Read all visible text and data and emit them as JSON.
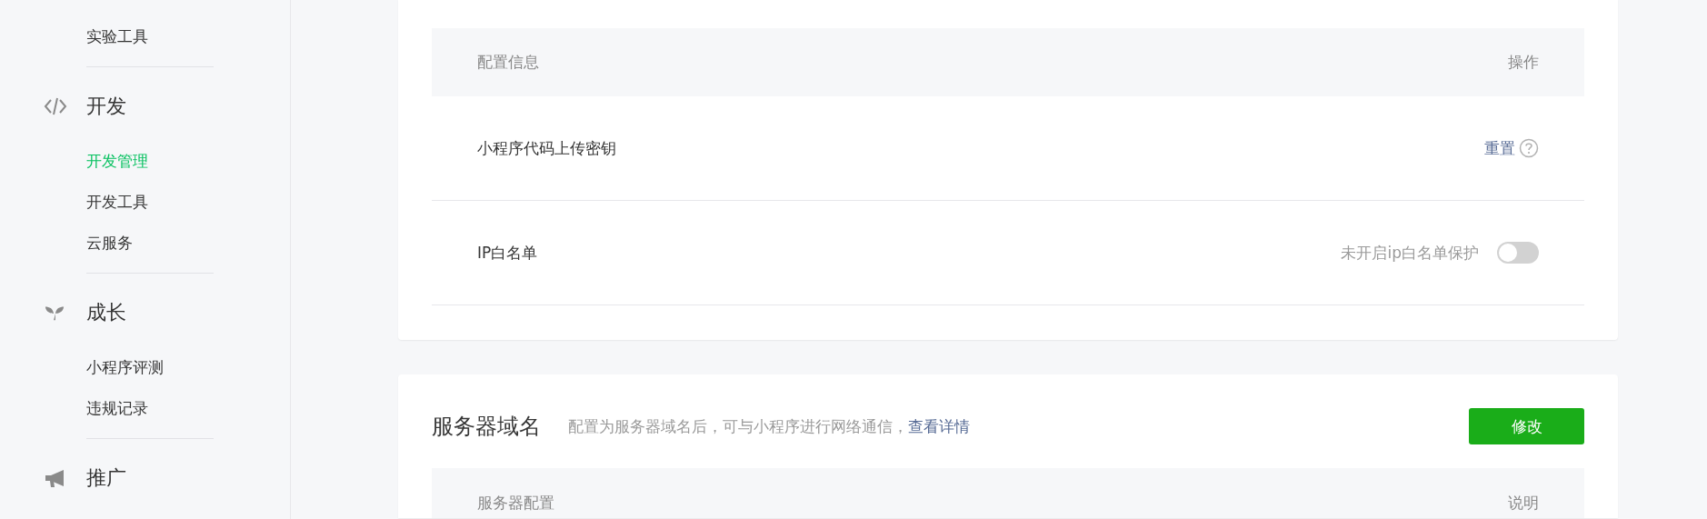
{
  "sidebar": {
    "sections": [
      {
        "items": [
          {
            "label": "实验工具",
            "selected": false
          }
        ]
      },
      {
        "title": "开发",
        "items": [
          {
            "label": "开发管理",
            "selected": true
          },
          {
            "label": "开发工具",
            "selected": false
          },
          {
            "label": "云服务",
            "selected": false
          }
        ]
      },
      {
        "title": "成长",
        "items": [
          {
            "label": "小程序评测",
            "selected": false
          },
          {
            "label": "违规记录",
            "selected": false
          }
        ]
      },
      {
        "title": "推广"
      }
    ]
  },
  "config_card": {
    "table": {
      "columns": [
        "配置信息",
        "操作"
      ],
      "rows": [
        {
          "kind": "link",
          "name": "小程序代码上传密钥",
          "action": "重置"
        },
        {
          "kind": "toggle",
          "name": "IP白名单",
          "status": "未开启ip白名单保护",
          "on": false
        }
      ]
    }
  },
  "server_card": {
    "title": "服务器域名",
    "description": "配置为服务器域名后，可与小程序进行网络通信，",
    "link": "查看详情",
    "button": "修改",
    "table": {
      "columns": [
        "服务器配置",
        "说明"
      ]
    }
  }
}
